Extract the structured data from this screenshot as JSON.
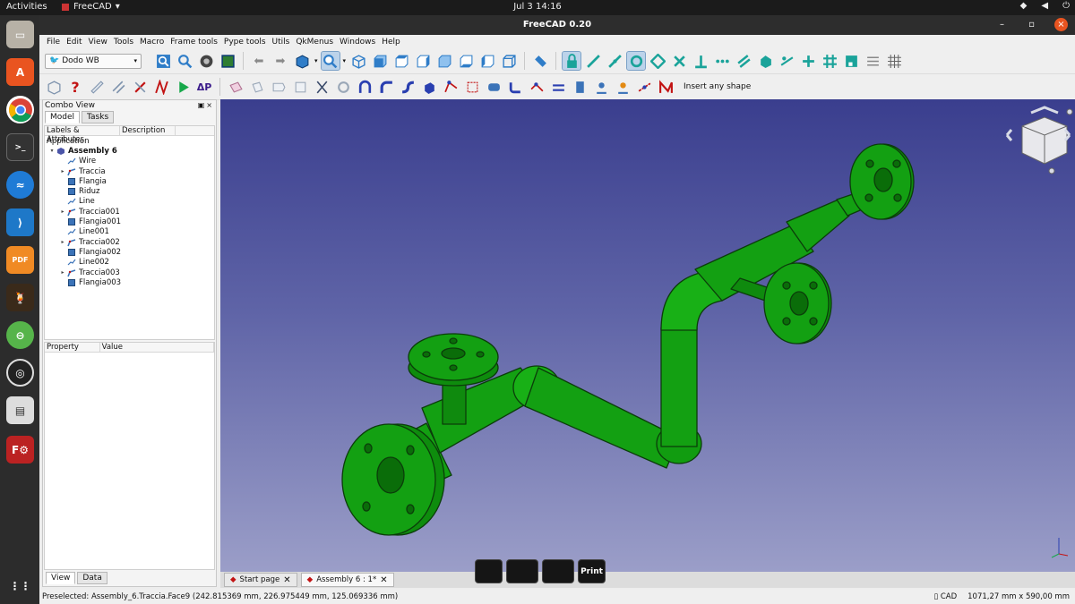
{
  "topbar": {
    "activities": "Activities",
    "app_name": "FreeCAD",
    "clock": "Jul 3  14:16"
  },
  "window": {
    "title": "FreeCAD 0.20"
  },
  "menu": [
    "File",
    "Edit",
    "View",
    "Tools",
    "Macro",
    "Frame tools",
    "Pype tools",
    "Utils",
    "QkMenus",
    "Windows",
    "Help"
  ],
  "workbench": {
    "selected": "Dodo WB"
  },
  "toolbar2": {
    "insert_label": "Insert any shape"
  },
  "combo": {
    "title": "Combo View",
    "tabs": [
      "Model",
      "Tasks"
    ],
    "tree_headers": [
      "Labels & Attributes",
      "Description"
    ],
    "root": "Application",
    "items": [
      {
        "label": "Assembly 6",
        "icon": "assembly-icon",
        "level": 0,
        "exp": "open"
      },
      {
        "label": "Wire",
        "icon": "wire-icon",
        "level": 1,
        "exp": ""
      },
      {
        "label": "Traccia",
        "icon": "sketch-icon",
        "level": 1,
        "exp": "closed"
      },
      {
        "label": "Flangia",
        "icon": "cube-icon",
        "level": 1,
        "exp": ""
      },
      {
        "label": "Riduz",
        "icon": "cube-icon",
        "level": 1,
        "exp": ""
      },
      {
        "label": "Line",
        "icon": "wire-icon",
        "level": 1,
        "exp": ""
      },
      {
        "label": "Traccia001",
        "icon": "sketch-icon",
        "level": 1,
        "exp": "closed"
      },
      {
        "label": "Flangia001",
        "icon": "cube-icon",
        "level": 1,
        "exp": ""
      },
      {
        "label": "Line001",
        "icon": "wire-icon",
        "level": 1,
        "exp": ""
      },
      {
        "label": "Traccia002",
        "icon": "sketch-icon",
        "level": 1,
        "exp": "closed"
      },
      {
        "label": "Flangia002",
        "icon": "cube-icon",
        "level": 1,
        "exp": ""
      },
      {
        "label": "Line002",
        "icon": "wire-icon",
        "level": 1,
        "exp": ""
      },
      {
        "label": "Traccia003",
        "icon": "sketch-icon",
        "level": 1,
        "exp": "closed"
      },
      {
        "label": "Flangia003",
        "icon": "cube-icon",
        "level": 1,
        "exp": ""
      }
    ],
    "prop_headers": [
      "Property",
      "Value"
    ],
    "view_tabs": [
      "View",
      "Data"
    ]
  },
  "doc_tabs": [
    {
      "label": "Start page",
      "active": false
    },
    {
      "label": "Assembly 6 : 1*",
      "active": true
    }
  ],
  "osd": [
    "",
    "",
    "",
    "Print"
  ],
  "status": {
    "left": "Preselected: Assembly_6.Traccia.Face9 (242.815369 mm, 226.975449 mm, 125.069336 mm)",
    "nav": "CAD",
    "dims": "1071,27 mm x 590,00 mm"
  },
  "colors": {
    "pipe": "#13a012",
    "pipe_edge": "#0b3d0a",
    "viewport_top": "#3a3e8e",
    "viewport_bottom": "#9b9ec8"
  }
}
